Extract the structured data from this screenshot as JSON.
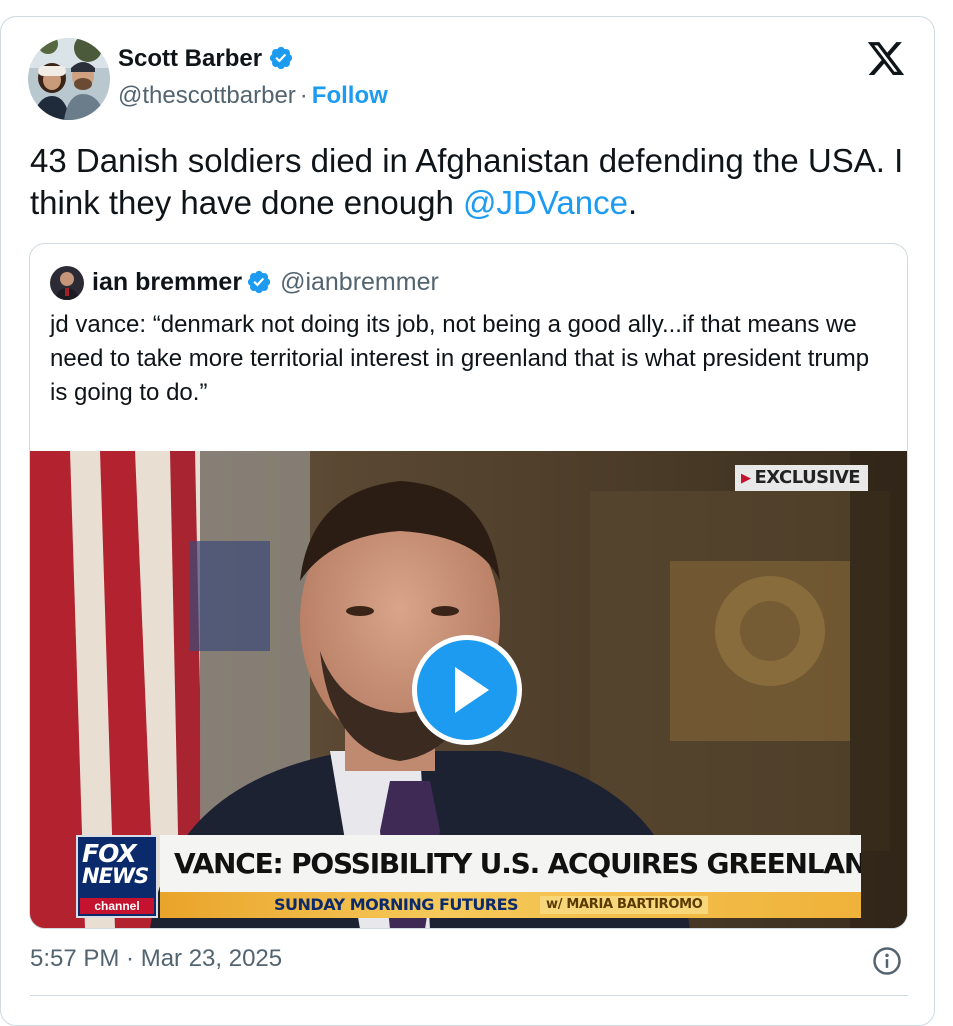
{
  "tweet": {
    "author": {
      "name": "Scott Barber",
      "handle": "@thescottbarber",
      "separator": "·",
      "follow_label": "Follow",
      "avatar_icon": "profile-photo-two-people"
    },
    "text_before_mention": "43 Danish soldiers died in Afghanistan defending the USA. I think they have done enough ",
    "mention": "@JDVance",
    "text_after_mention": ".",
    "timestamp": "5:57 PM · Mar 23, 2025",
    "brand_icon": "x-logo-icon",
    "info_icon": "info-icon"
  },
  "quoted_tweet": {
    "name": "ian bremmer",
    "handle": "@ianbremmer",
    "text": "jd vance: “denmark not doing its job, not being a good ally...if that means we need to take more territorial interest in greenland that is what president trump is going to do.”",
    "video": {
      "badge": "EXCLUSIVE",
      "logo_fox": "FOX",
      "logo_news": "NEWS",
      "logo_channel": "channel",
      "headline": "VANCE: POSSIBILITY U.S. ACQUIRES GREENLAND",
      "show": "SUNDAY MORNING FUTURES",
      "host": "w/ MARIA BARTIROMO",
      "play_icon": "play-icon"
    }
  },
  "colors": {
    "accent": "#1d9bf0",
    "text": "#0f1419",
    "secondary": "#536471",
    "border": "#cfd9de"
  }
}
